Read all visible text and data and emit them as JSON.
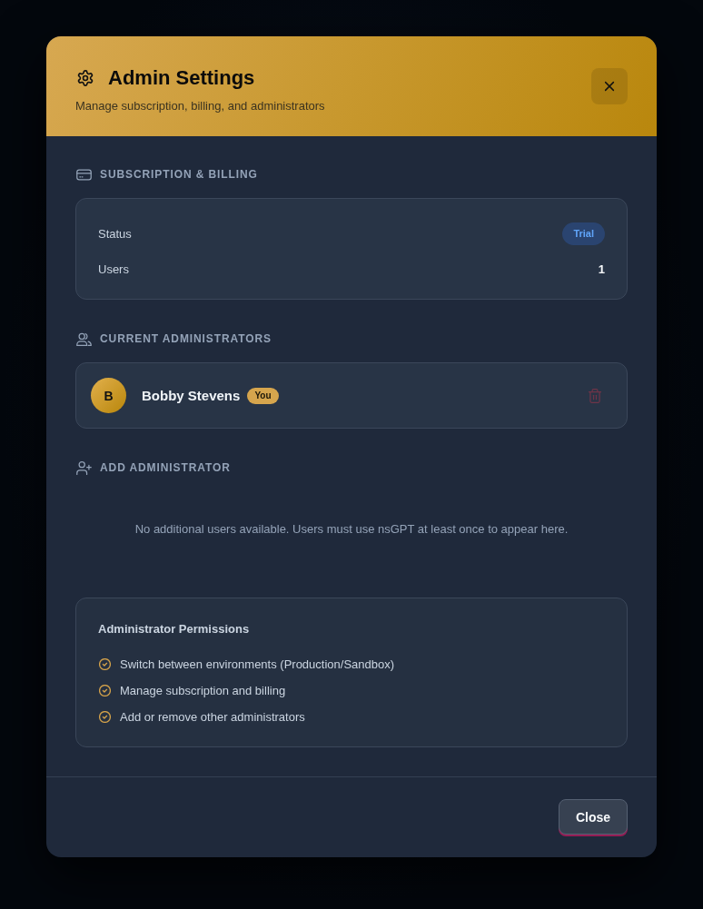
{
  "dialog": {
    "title": "Admin Settings",
    "subtitle": "Manage subscription, billing, and administrators"
  },
  "sections": [
    {
      "kind": "billing",
      "heading": "SUBSCRIPTION & BILLING",
      "rows": [
        {
          "label": "Status",
          "value": "Trial",
          "kind": "badge"
        },
        {
          "label": "Users",
          "value": "1",
          "kind": "text"
        }
      ]
    },
    {
      "kind": "admins",
      "heading": "CURRENT ADMINISTRATORS",
      "admins": [
        {
          "initial": "B",
          "name": "Bobby Stevens",
          "badge": "You",
          "remove_disabled": true
        }
      ]
    },
    {
      "kind": "add",
      "heading": "ADD ADMINISTRATOR",
      "empty_message": "No additional users available. Users must use nsGPT at least once to appear here."
    }
  ],
  "permissions": {
    "title": "Administrator Permissions",
    "items": [
      "Switch between environments (Production/Sandbox)",
      "Manage subscription and billing",
      "Add or remove other administrators"
    ]
  },
  "footer": {
    "buttons": [
      "Close"
    ]
  }
}
